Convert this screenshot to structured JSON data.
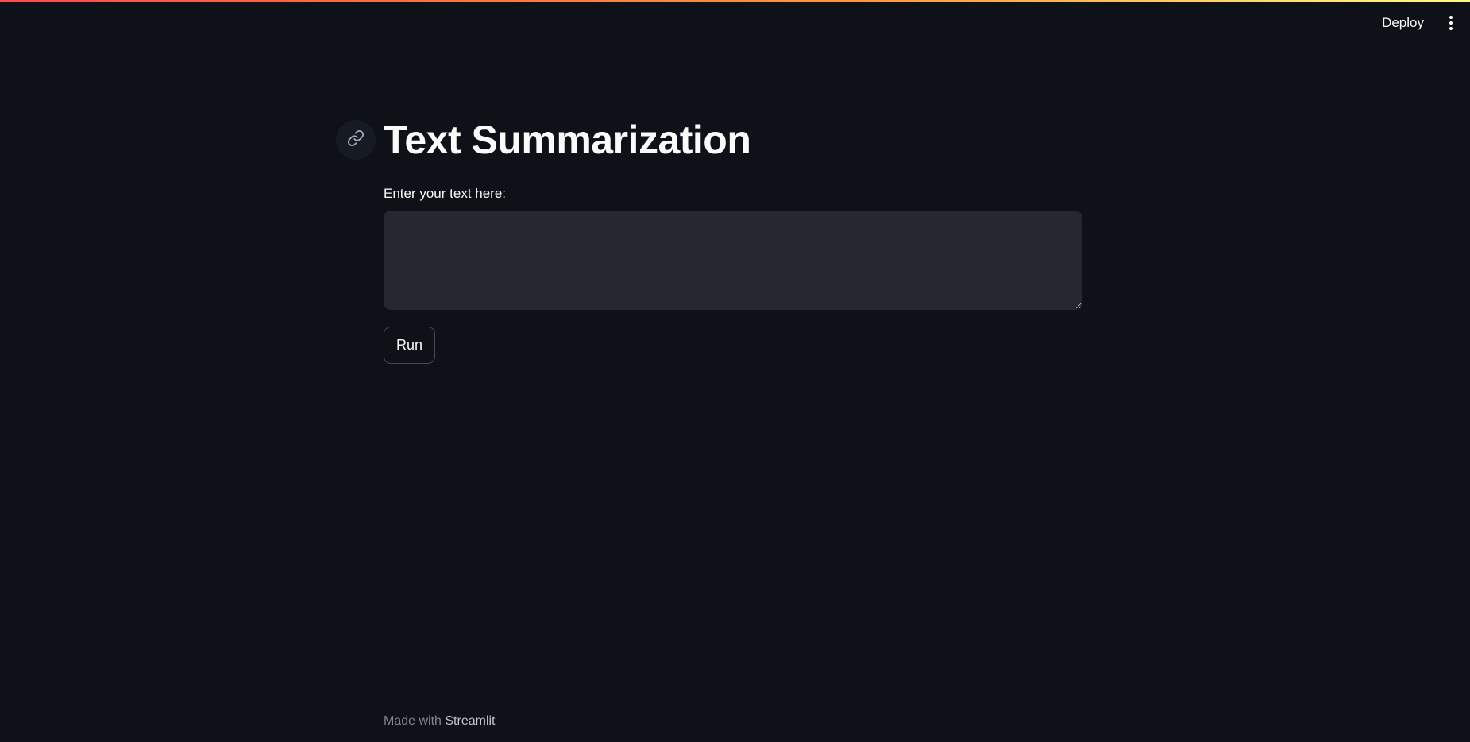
{
  "header": {
    "deploy_label": "Deploy",
    "menu_icon": "kebab-menu-icon"
  },
  "main": {
    "title": "Text Summarization",
    "anchor_icon": "link-icon",
    "text_input": {
      "label": "Enter your text here:",
      "value": "",
      "placeholder": ""
    },
    "run_label": "Run"
  },
  "footer": {
    "prefix": "Made with",
    "brand": "Streamlit"
  },
  "colors": {
    "background": "#0e1117",
    "input_background": "#262730",
    "text": "#fafafa",
    "accent_gradient_start": "#ff4b4b",
    "accent_gradient_end": "#fffd80"
  }
}
